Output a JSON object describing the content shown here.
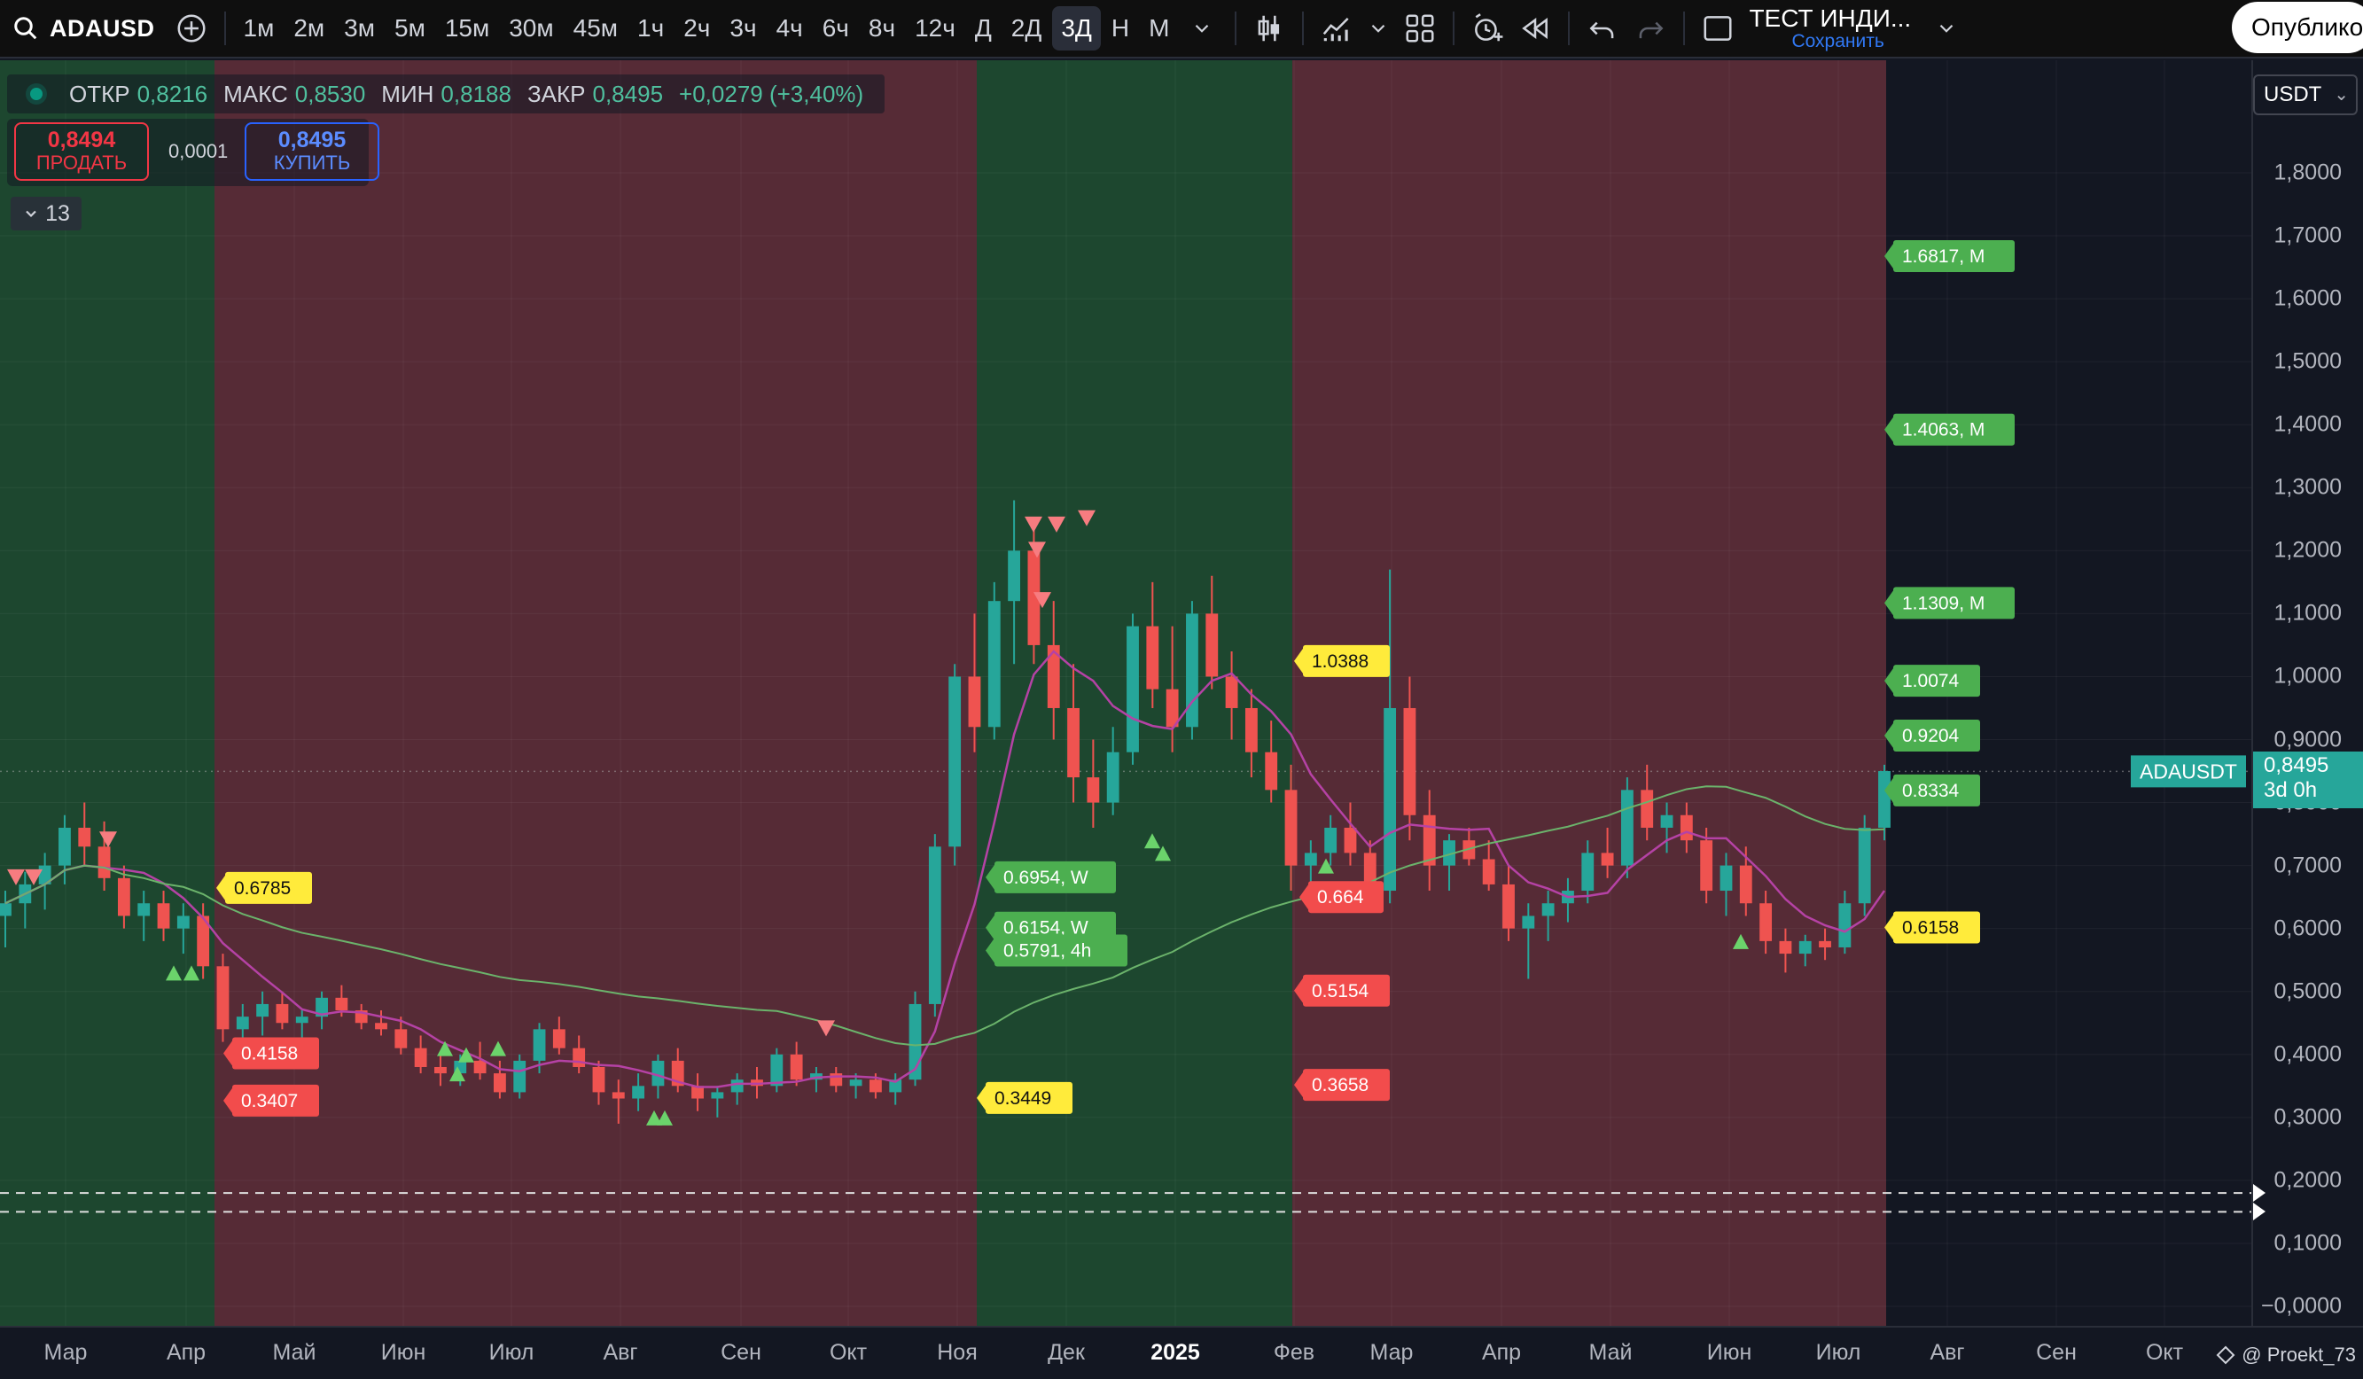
{
  "toolbar": {
    "symbol": "ADAUSD",
    "intervals": [
      "1м",
      "2м",
      "3м",
      "5м",
      "15м",
      "30м",
      "45м",
      "1ч",
      "2ч",
      "3ч",
      "4ч",
      "6ч",
      "8ч",
      "12ч",
      "Д",
      "2Д",
      "3Д",
      "Н",
      "М"
    ],
    "active_interval": "3Д",
    "indicator_template_title": "ТЕСТ ИНДИ...",
    "save_label": "Сохранить",
    "publish_label": "Опубликовать"
  },
  "legend": {
    "open_label": "ОТКР",
    "open": "0,8216",
    "high_label": "МАКС",
    "high": "0,8530",
    "low_label": "МИН",
    "low": "0,8188",
    "close_label": "ЗАКР",
    "close": "0,8495",
    "change": "+0,0279 (+3,40%)"
  },
  "trade": {
    "sell_price": "0,8494",
    "sell_label": "ПРОДАТЬ",
    "spread": "0,0001",
    "buy_price": "0,8495",
    "buy_label": "КУПИТЬ"
  },
  "indicators_count": "13",
  "currency": "USDT",
  "current_price": {
    "symbol": "ADAUSDT",
    "price": "0,8495",
    "countdown": "3d 0h"
  },
  "price_axis_labels": [
    "1,8000",
    "1,7000",
    "1,6000",
    "1,5000",
    "1,4000",
    "1,3000",
    "1,2000",
    "1,1000",
    "1,0000",
    "0,9000",
    "0,8000",
    "0,7000",
    "0,6000",
    "0,5000",
    "0,4000",
    "0,3000",
    "0,2000",
    "0,1000",
    "−0,0000"
  ],
  "time_axis_labels": [
    "Мар",
    "Апр",
    "Май",
    "Июн",
    "Июл",
    "Авг",
    "Сен",
    "Окт",
    "Ноя",
    "Дек",
    "2025",
    "Фев",
    "Мар",
    "Апр",
    "Май",
    "Июн",
    "Июл",
    "Авг",
    "Сен",
    "Окт"
  ],
  "credit": "@ Proekt_73",
  "colors": {
    "up": "#26a69a",
    "down": "#ef5350",
    "bull_zone": "#1e4a30",
    "bear_zone": "#5a2c38",
    "ma_fast": "#b542a5",
    "ma_slow": "#6bb36b"
  },
  "chart_data": {
    "type": "candlestick",
    "title": "ADAUSD 3Д",
    "ylim": [
      0,
      1.9
    ],
    "regimes": [
      {
        "from": "Мар",
        "to": "Апр",
        "state": "bull"
      },
      {
        "from": "Апр",
        "to": "Ноя",
        "state": "bear"
      },
      {
        "from": "Ноя",
        "to": "Фев",
        "state": "bull"
      },
      {
        "from": "Фев",
        "to": "Июл",
        "state": "bear"
      }
    ],
    "level_labels": [
      {
        "text": "0.6785",
        "value": 0.6785,
        "color": "yellow"
      },
      {
        "text": "0.4158",
        "value": 0.4158,
        "color": "red"
      },
      {
        "text": "0.3407",
        "value": 0.3407,
        "color": "red"
      },
      {
        "text": "0.6954, W",
        "value": 0.6954,
        "color": "green"
      },
      {
        "text": "0.6154, W",
        "value": 0.6154,
        "color": "green"
      },
      {
        "text": "0.5791, 4h",
        "value": 0.5791,
        "color": "green"
      },
      {
        "text": "0.3449",
        "value": 0.3449,
        "color": "yellow"
      },
      {
        "text": "1.0388",
        "value": 1.0388,
        "color": "yellow"
      },
      {
        "text": "0.664",
        "value": 0.664,
        "color": "red"
      },
      {
        "text": "0.5154",
        "value": 0.5154,
        "color": "red"
      },
      {
        "text": "0.3658",
        "value": 0.3658,
        "color": "red"
      },
      {
        "text": "1.6817, M",
        "value": 1.6817,
        "color": "green"
      },
      {
        "text": "1.4063, M",
        "value": 1.4063,
        "color": "green"
      },
      {
        "text": "1.1309, M",
        "value": 1.1309,
        "color": "green"
      },
      {
        "text": "1.0074",
        "value": 1.0074,
        "color": "green"
      },
      {
        "text": "0.9204",
        "value": 0.9204,
        "color": "green"
      },
      {
        "text": "0.8334",
        "value": 0.8334,
        "color": "green"
      },
      {
        "text": "0.6158",
        "value": 0.6158,
        "color": "yellow"
      }
    ],
    "candles": [
      [
        0.62,
        0.66,
        0.57,
        0.64
      ],
      [
        0.64,
        0.69,
        0.6,
        0.67
      ],
      [
        0.67,
        0.72,
        0.63,
        0.7
      ],
      [
        0.7,
        0.78,
        0.67,
        0.76
      ],
      [
        0.76,
        0.8,
        0.7,
        0.73
      ],
      [
        0.73,
        0.77,
        0.66,
        0.68
      ],
      [
        0.68,
        0.7,
        0.6,
        0.62
      ],
      [
        0.62,
        0.66,
        0.58,
        0.64
      ],
      [
        0.64,
        0.66,
        0.58,
        0.6
      ],
      [
        0.6,
        0.64,
        0.56,
        0.62
      ],
      [
        0.62,
        0.64,
        0.52,
        0.54
      ],
      [
        0.54,
        0.56,
        0.42,
        0.44
      ],
      [
        0.44,
        0.48,
        0.41,
        0.46
      ],
      [
        0.46,
        0.5,
        0.43,
        0.48
      ],
      [
        0.48,
        0.5,
        0.44,
        0.45
      ],
      [
        0.45,
        0.47,
        0.42,
        0.46
      ],
      [
        0.46,
        0.5,
        0.44,
        0.49
      ],
      [
        0.49,
        0.51,
        0.46,
        0.47
      ],
      [
        0.47,
        0.48,
        0.44,
        0.45
      ],
      [
        0.45,
        0.47,
        0.43,
        0.44
      ],
      [
        0.44,
        0.46,
        0.4,
        0.41
      ],
      [
        0.41,
        0.43,
        0.37,
        0.38
      ],
      [
        0.38,
        0.4,
        0.35,
        0.37
      ],
      [
        0.37,
        0.4,
        0.35,
        0.39
      ],
      [
        0.39,
        0.42,
        0.36,
        0.37
      ],
      [
        0.37,
        0.39,
        0.33,
        0.34
      ],
      [
        0.34,
        0.4,
        0.33,
        0.39
      ],
      [
        0.39,
        0.45,
        0.37,
        0.44
      ],
      [
        0.44,
        0.46,
        0.4,
        0.41
      ],
      [
        0.41,
        0.43,
        0.37,
        0.38
      ],
      [
        0.38,
        0.39,
        0.32,
        0.34
      ],
      [
        0.34,
        0.36,
        0.29,
        0.33
      ],
      [
        0.33,
        0.37,
        0.31,
        0.35
      ],
      [
        0.35,
        0.4,
        0.33,
        0.39
      ],
      [
        0.39,
        0.41,
        0.34,
        0.35
      ],
      [
        0.35,
        0.37,
        0.31,
        0.33
      ],
      [
        0.33,
        0.35,
        0.3,
        0.34
      ],
      [
        0.34,
        0.37,
        0.32,
        0.36
      ],
      [
        0.36,
        0.38,
        0.33,
        0.35
      ],
      [
        0.35,
        0.41,
        0.34,
        0.4
      ],
      [
        0.4,
        0.42,
        0.35,
        0.36
      ],
      [
        0.36,
        0.38,
        0.34,
        0.37
      ],
      [
        0.37,
        0.38,
        0.34,
        0.35
      ],
      [
        0.35,
        0.37,
        0.33,
        0.36
      ],
      [
        0.36,
        0.37,
        0.33,
        0.34
      ],
      [
        0.34,
        0.37,
        0.32,
        0.36
      ],
      [
        0.36,
        0.5,
        0.35,
        0.48
      ],
      [
        0.48,
        0.75,
        0.46,
        0.73
      ],
      [
        0.73,
        1.02,
        0.7,
        1.0
      ],
      [
        1.0,
        1.1,
        0.88,
        0.92
      ],
      [
        0.92,
        1.15,
        0.9,
        1.12
      ],
      [
        1.12,
        1.28,
        1.02,
        1.2
      ],
      [
        1.2,
        1.25,
        1.02,
        1.05
      ],
      [
        1.05,
        1.12,
        0.9,
        0.95
      ],
      [
        0.95,
        1.02,
        0.8,
        0.84
      ],
      [
        0.84,
        0.9,
        0.76,
        0.8
      ],
      [
        0.8,
        0.92,
        0.78,
        0.88
      ],
      [
        0.88,
        1.1,
        0.86,
        1.08
      ],
      [
        1.08,
        1.15,
        0.95,
        0.98
      ],
      [
        0.98,
        1.08,
        0.88,
        0.92
      ],
      [
        0.92,
        1.12,
        0.9,
        1.1
      ],
      [
        1.1,
        1.16,
        0.98,
        1.0
      ],
      [
        1.0,
        1.04,
        0.9,
        0.95
      ],
      [
        0.95,
        0.98,
        0.84,
        0.88
      ],
      [
        0.88,
        0.93,
        0.8,
        0.82
      ],
      [
        0.82,
        0.86,
        0.66,
        0.7
      ],
      [
        0.7,
        0.74,
        0.66,
        0.72
      ],
      [
        0.72,
        0.78,
        0.7,
        0.76
      ],
      [
        0.76,
        0.8,
        0.7,
        0.72
      ],
      [
        0.72,
        0.74,
        0.64,
        0.66
      ],
      [
        0.66,
        1.17,
        0.64,
        0.95
      ],
      [
        0.95,
        1.0,
        0.74,
        0.78
      ],
      [
        0.78,
        0.82,
        0.66,
        0.7
      ],
      [
        0.7,
        0.75,
        0.66,
        0.74
      ],
      [
        0.74,
        0.76,
        0.7,
        0.71
      ],
      [
        0.71,
        0.74,
        0.66,
        0.67
      ],
      [
        0.67,
        0.7,
        0.58,
        0.6
      ],
      [
        0.6,
        0.64,
        0.52,
        0.62
      ],
      [
        0.62,
        0.66,
        0.58,
        0.64
      ],
      [
        0.64,
        0.68,
        0.61,
        0.66
      ],
      [
        0.66,
        0.74,
        0.64,
        0.72
      ],
      [
        0.72,
        0.76,
        0.68,
        0.7
      ],
      [
        0.7,
        0.84,
        0.68,
        0.82
      ],
      [
        0.82,
        0.86,
        0.74,
        0.76
      ],
      [
        0.76,
        0.8,
        0.72,
        0.78
      ],
      [
        0.78,
        0.8,
        0.72,
        0.74
      ],
      [
        0.74,
        0.76,
        0.64,
        0.66
      ],
      [
        0.66,
        0.72,
        0.62,
        0.7
      ],
      [
        0.7,
        0.73,
        0.62,
        0.64
      ],
      [
        0.64,
        0.66,
        0.56,
        0.58
      ],
      [
        0.58,
        0.6,
        0.53,
        0.56
      ],
      [
        0.56,
        0.59,
        0.54,
        0.58
      ],
      [
        0.58,
        0.6,
        0.55,
        0.57
      ],
      [
        0.57,
        0.66,
        0.56,
        0.64
      ],
      [
        0.64,
        0.78,
        0.62,
        0.76
      ],
      [
        0.76,
        0.86,
        0.74,
        0.85
      ]
    ]
  }
}
